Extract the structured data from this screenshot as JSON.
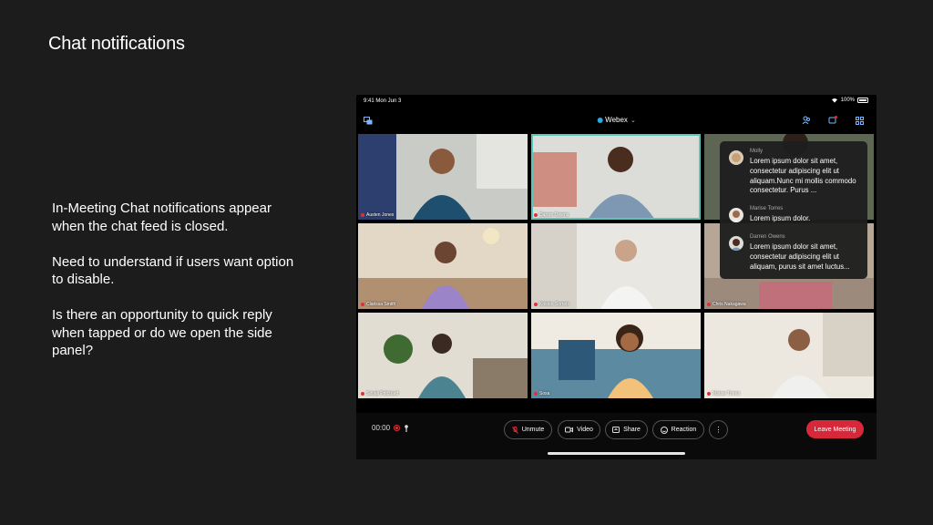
{
  "slide": {
    "title": "Chat notifications",
    "notes": [
      "In-Meeting Chat notifications appear when the chat feed is closed.",
      "Need to understand if users want option to disable.",
      "Is there an opportunity to quick reply when tapped or do we open the side panel?"
    ]
  },
  "status_bar": {
    "time": "9:41  Mon Jun 3",
    "battery": "100%"
  },
  "header": {
    "title": "Webex"
  },
  "participants": [
    {
      "name": "Austen Jones",
      "muted": true
    },
    {
      "name": "Darren Owens",
      "muted": true,
      "active": true
    },
    {
      "name": ""
    },
    {
      "name": "Clarissa Smith",
      "muted": true
    },
    {
      "name": "Kristen Sorrels",
      "muted": true
    },
    {
      "name": "Chris Nakagawa",
      "muted": true
    },
    {
      "name": "Sonali Pritchard",
      "muted": true
    },
    {
      "name": "Sosa",
      "muted": true
    },
    {
      "name": "Marise Torres",
      "muted": true
    }
  ],
  "chat": [
    {
      "sender": "Molly",
      "text": "Lorem ipsum dolor sit amet, consectetur adipiscing elit ut aliquam.Nunc mi mollis commodo consectetur. Purus ..."
    },
    {
      "sender": "Marise Torres",
      "text": "Lorem ipsum dolor."
    },
    {
      "sender": "Darren Owens",
      "text": "Lorem ipsum dolor sit amet, consectetur adipiscing elit ut aliquam, purus sit amet luctus..."
    }
  ],
  "controls": {
    "timer": "00:00",
    "unmute": "Unmute",
    "video": "Video",
    "share": "Share",
    "reaction": "Reaction",
    "more": "⋮",
    "leave": "Leave Meeting"
  },
  "colors": {
    "accent_active": "#5ac5b8",
    "leave": "#d7283a",
    "webex": "#2ea8e0"
  }
}
